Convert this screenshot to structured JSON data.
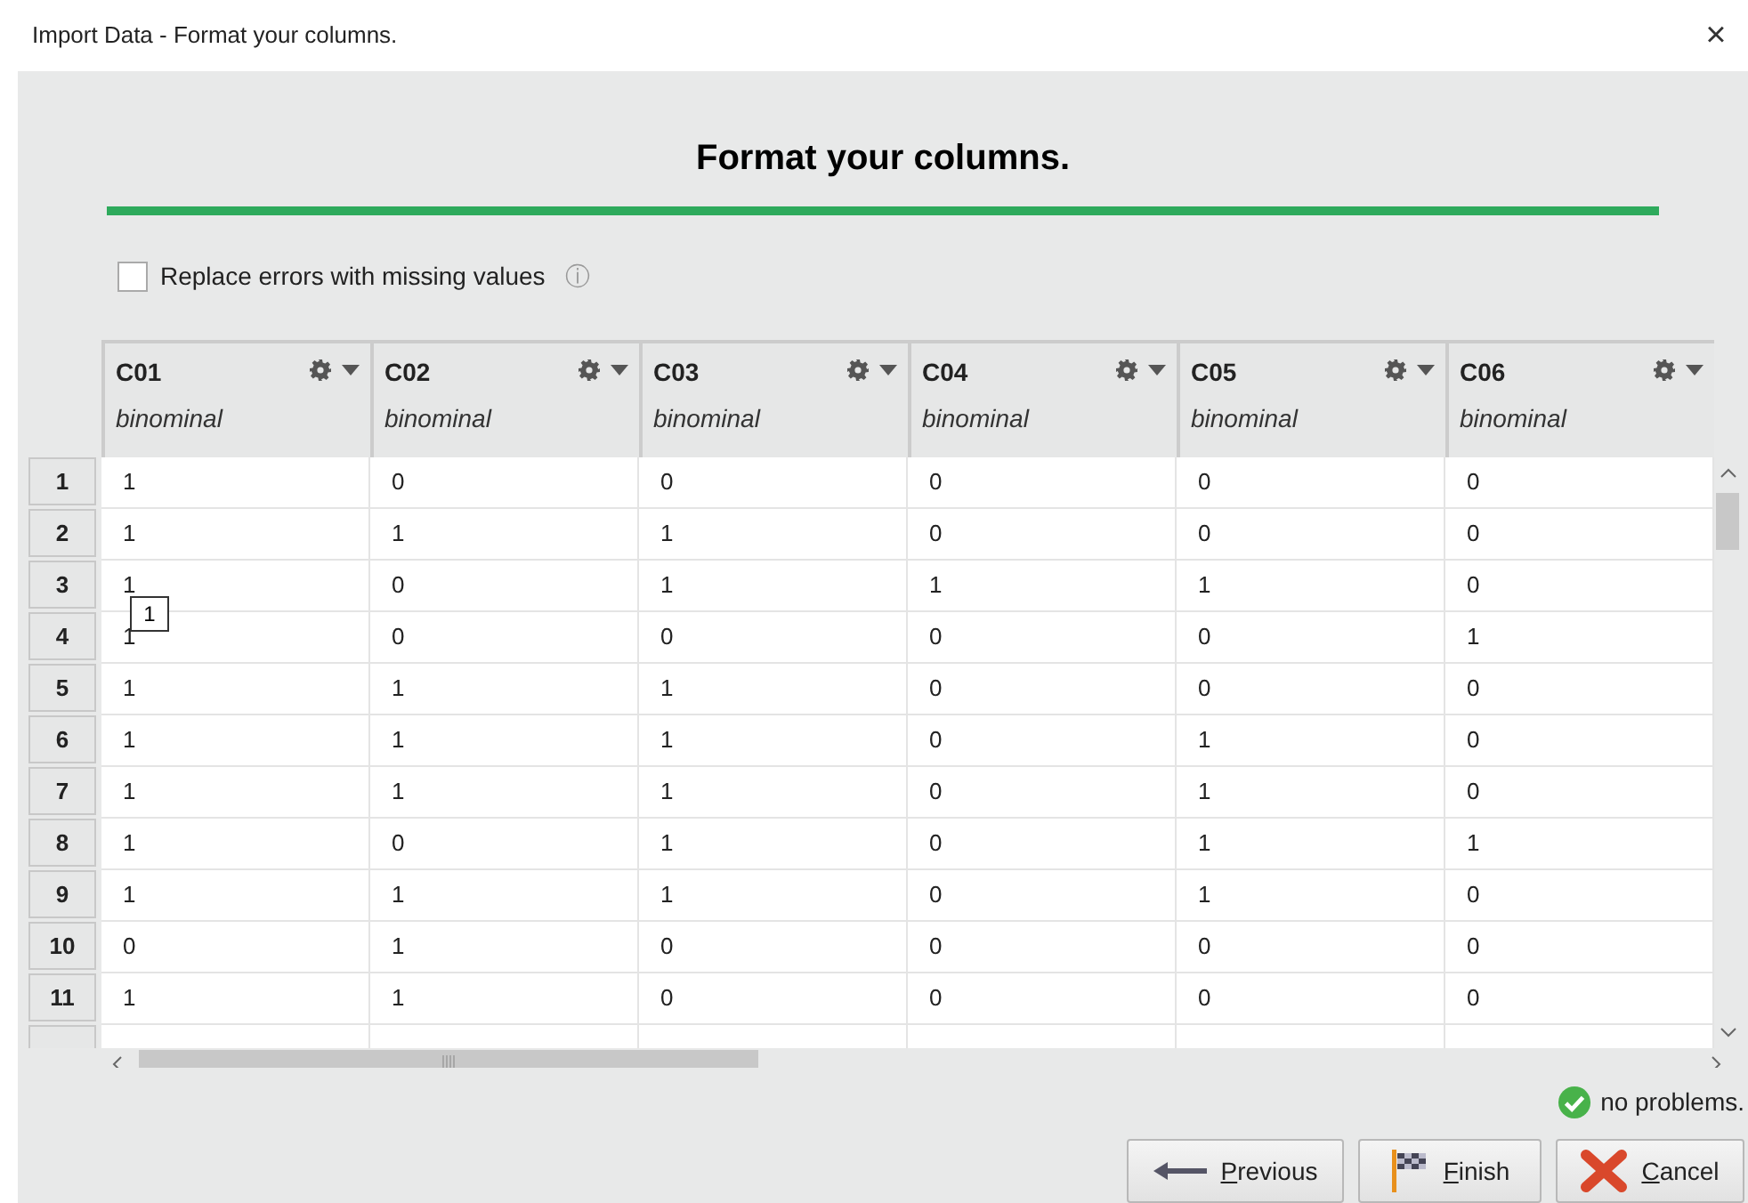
{
  "window": {
    "title": "Import Data - Format your columns.",
    "close": "×"
  },
  "heading": "Format your columns.",
  "progress": {
    "level": 1
  },
  "replace_errors": {
    "label": "Replace errors with missing values",
    "checked": false,
    "info": "ⓘ"
  },
  "table": {
    "columns": [
      {
        "name": "C01",
        "type": "binominal"
      },
      {
        "name": "C02",
        "type": "binominal"
      },
      {
        "name": "C03",
        "type": "binominal"
      },
      {
        "name": "C04",
        "type": "binominal"
      },
      {
        "name": "C05",
        "type": "binominal"
      },
      {
        "name": "C06",
        "type": "binominal"
      }
    ],
    "rows": [
      {
        "number": "1",
        "cells": [
          "1",
          "0",
          "0",
          "0",
          "0",
          "0"
        ]
      },
      {
        "number": "2",
        "cells": [
          "1",
          "1",
          "1",
          "0",
          "0",
          "0"
        ]
      },
      {
        "number": "3",
        "cells": [
          "1",
          "0",
          "1",
          "1",
          "1",
          "0"
        ]
      },
      {
        "number": "4",
        "cells": [
          "1",
          "0",
          "0",
          "0",
          "0",
          "1"
        ]
      },
      {
        "number": "5",
        "cells": [
          "1",
          "1",
          "1",
          "0",
          "0",
          "0"
        ]
      },
      {
        "number": "6",
        "cells": [
          "1",
          "1",
          "1",
          "0",
          "1",
          "0"
        ]
      },
      {
        "number": "7",
        "cells": [
          "1",
          "1",
          "1",
          "0",
          "1",
          "0"
        ]
      },
      {
        "number": "8",
        "cells": [
          "1",
          "0",
          "1",
          "0",
          "1",
          "1"
        ]
      },
      {
        "number": "9",
        "cells": [
          "1",
          "1",
          "1",
          "0",
          "1",
          "0"
        ]
      },
      {
        "number": "10",
        "cells": [
          "0",
          "1",
          "0",
          "0",
          "0",
          "0"
        ]
      },
      {
        "number": "11",
        "cells": [
          "1",
          "1",
          "0",
          "0",
          "0",
          "0"
        ]
      }
    ],
    "tooltip": "1"
  },
  "status": "no problems.",
  "buttons": [
    {
      "kind": "previous",
      "label": "Previous"
    },
    {
      "kind": "finish",
      "label": "Finish"
    },
    {
      "kind": "cancel",
      "label": "Cancel"
    }
  ]
}
